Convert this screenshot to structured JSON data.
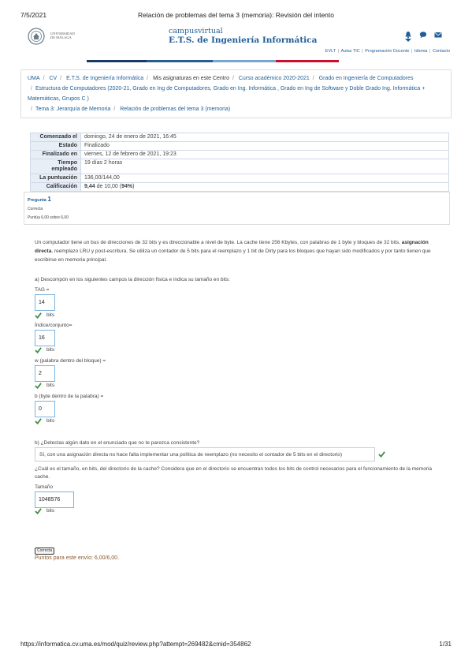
{
  "print": {
    "date": "7/5/2021",
    "title": "Relación de problemas del tema 3 (memoria): Revisión del intento",
    "url": "https://informatica.cv.uma.es/mod/quiz/review.php?attempt=269482&cmid=354862",
    "page": "1/31"
  },
  "header": {
    "logo_text_1": "UNIVERSIDAD",
    "logo_text_2": "DE MÁLAGA",
    "brand_line1": "campusvirtual",
    "brand_line2": "E.T.S. de Ingeniería Informática",
    "icons": [
      "bell-icon",
      "chat-icon",
      "mail-icon"
    ],
    "quick_links": [
      "EVLT",
      "Aulas TIC",
      "Programación Docente",
      "Idioma",
      "Contacto"
    ],
    "bar_colors": [
      "#ffffff",
      "#1a3a66",
      "#2a5d8f",
      "#7aa6cc",
      "#c8102e"
    ]
  },
  "breadcrumb": [
    "UMA",
    "CV",
    "E.T.S. de Ingeniería Informática",
    "Mis asignaturas en este Centro",
    "Curso académico 2020-2021",
    "Grado en Ingeniería de Computadores",
    "Estructura de Computadores (2020-21, Grado en Ing de Computadores, Grado en Ing. Informática , Grado en Ing de Software y Doble Grado Ing. Informática + Matemáticas, Grupos C )",
    "Tema 3: Jerarquía de Memoria",
    "Relación de problemas del tema 3 (memoria)"
  ],
  "summary": [
    {
      "label": "Comenzado el",
      "value": "domingo, 24 de enero de 2021, 16:45"
    },
    {
      "label": "Estado",
      "value": "Finalizado"
    },
    {
      "label": "Finalizado en",
      "value": "viernes, 12 de febrero de 2021, 19:23"
    },
    {
      "label": "Tiempo empleado",
      "value": "19 días 2 horas"
    },
    {
      "label": "La puntuación",
      "value": "136,00/144,00"
    },
    {
      "label": "Calificación",
      "value_bold": "9,44",
      "value_mid": " de 10,00 (",
      "value_pct": "94%",
      "value_end": ")"
    }
  ],
  "question_info": {
    "label": "Pregunta",
    "number": "1",
    "state": "Correcta",
    "mark": "Puntúa 6,00 sobre 6,00"
  },
  "question": {
    "intro_1": "Un computador tiene un bus de direcciones de 32 bits y es direccionable a nivel de byte. La cache tiene 256 Kbytes, con palabras de 1 byte y bloques de 32 bits,",
    "intro_bold": "asignación directa",
    "intro_2": ", reemplazo LRU y post-escritura. Se utiliza un contador de 5 bits para el reemplazo y 1 bit de Dirty para los bloques que hayan sido modificados y por tanto tienen que escribirse en memoria principal.",
    "part_a": "a) Descompón en los siguientes campos la dirección física e indica su tamaño en bits:",
    "fields": [
      {
        "label": "TAG =",
        "value": "14",
        "unit": "bits"
      },
      {
        "label": "Índice/conjunto=",
        "value": "16",
        "unit": "bits"
      },
      {
        "label": "w (palabra dentro del bloque) =",
        "value": "2",
        "unit": "bits"
      },
      {
        "label": "b (byte dentro de la palabra) =",
        "value": "0",
        "unit": "bits"
      }
    ],
    "part_b": "b) ¿Detectas algún dato en el enunciado que no te parezca consistente?",
    "part_b_answer": "Sí, con una asignación directa no hace falta implementar una  política de reemplazo (no necesito el contador de 5 bits en el directorio)",
    "part_c": "¿Cuál es el tamaño, en bits, del directorio de la cache? Considera que en el directorio se encuentran todos los bits de control necesarios para el funcionamiento de la memoria cache.",
    "size_label": "Tamaño",
    "size_value": "1048576",
    "size_unit": "bits",
    "result_badge": "Correcta",
    "points": "Puntos para este envío: 6,00/6,00."
  }
}
